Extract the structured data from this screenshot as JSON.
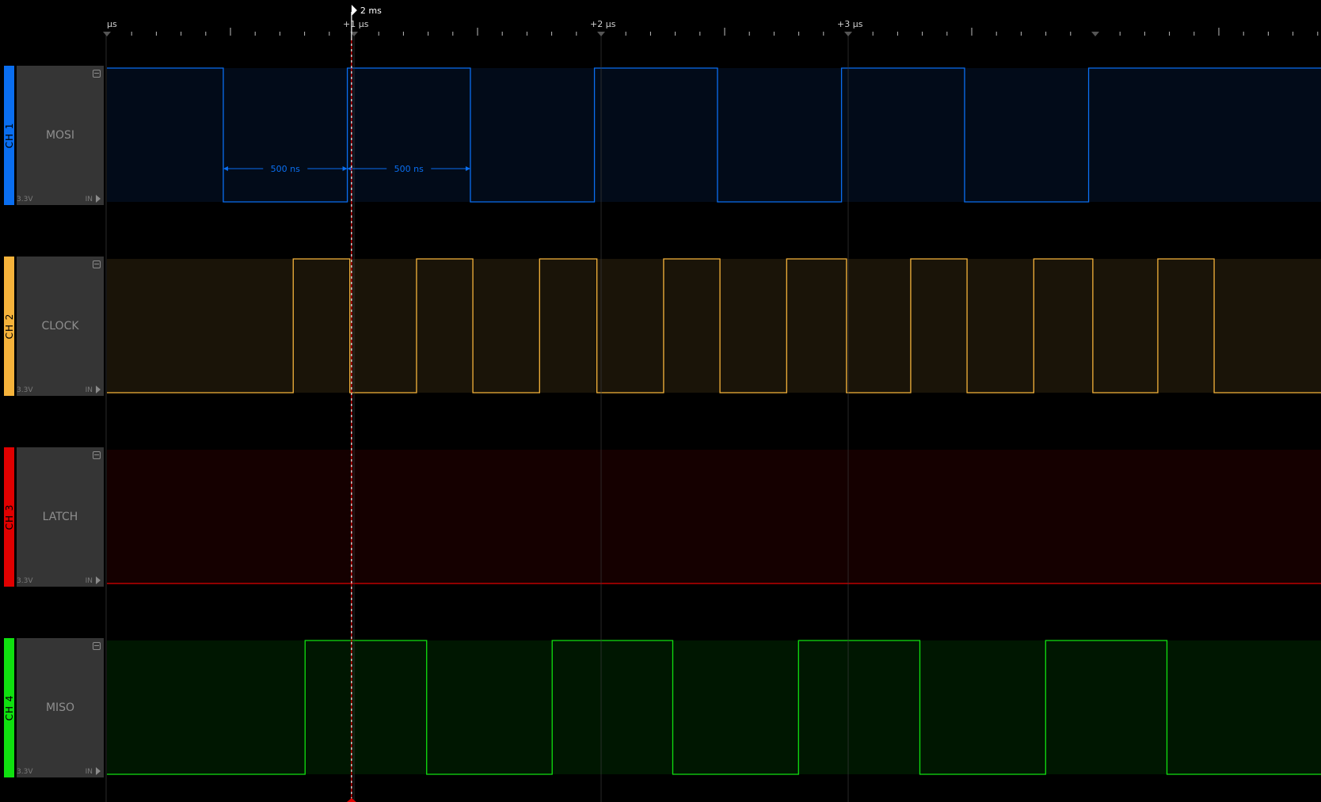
{
  "app": "Logic analyzer waveform view",
  "colors": {
    "ch1": "#0a6ef0",
    "ch2": "#f5b33b",
    "ch3": "#e00000",
    "ch4": "#10e010",
    "ch1_bg": "#020b19",
    "ch2_bg": "#1a1408",
    "ch3_bg": "#150000",
    "ch4_bg": "#001701",
    "trigger": "#e00000",
    "ruler_text": "#d0d0d0"
  },
  "timeline": {
    "trigger_label": "2 ms",
    "trigger_time_us": 0.99,
    "view_start_us": -0.02,
    "view_end_us": 4.91,
    "major_labels": [
      {
        "t_us": 0,
        "label": "µs"
      },
      {
        "t_us": 1,
        "label": "+1 µs"
      },
      {
        "t_us": 2,
        "label": "+2 µs"
      },
      {
        "t_us": 3,
        "label": "+3 µs"
      }
    ],
    "minor_tick_us": 0.1,
    "mid_tick_us": 0.5
  },
  "channels": [
    {
      "id": "ch1",
      "strip_label": "CH 1",
      "name": "MOSI",
      "voltage": "3.3V",
      "direction": "IN",
      "initial_level": 1,
      "edges_us": [
        0.471,
        0.973,
        1.471,
        1.973,
        2.471,
        2.973,
        3.471,
        3.973
      ]
    },
    {
      "id": "ch2",
      "strip_label": "CH 2",
      "name": "CLOCK",
      "voltage": "3.3V",
      "direction": "IN",
      "initial_level": 0,
      "edges_us": [
        0.754,
        0.983,
        1.253,
        1.481,
        1.751,
        1.983,
        2.253,
        2.481,
        2.751,
        2.993,
        3.253,
        3.481,
        3.751,
        3.99,
        4.253,
        4.481
      ]
    },
    {
      "id": "ch3",
      "strip_label": "CH 3",
      "name": "LATCH",
      "voltage": "3.3V",
      "direction": "IN",
      "initial_level": 0,
      "edges_us": []
    },
    {
      "id": "ch4",
      "strip_label": "CH 4",
      "name": "MISO",
      "voltage": "3.3V",
      "direction": "IN",
      "initial_level": 0,
      "edges_us": [
        0.802,
        1.294,
        1.802,
        2.29,
        2.799,
        3.29,
        3.799,
        4.29
      ]
    }
  ],
  "measurements": [
    {
      "channel": "ch1",
      "from_us": 0.471,
      "to_us": 0.973,
      "label": "500 ns"
    },
    {
      "channel": "ch1",
      "from_us": 0.973,
      "to_us": 1.471,
      "label": "500 ns"
    }
  ]
}
